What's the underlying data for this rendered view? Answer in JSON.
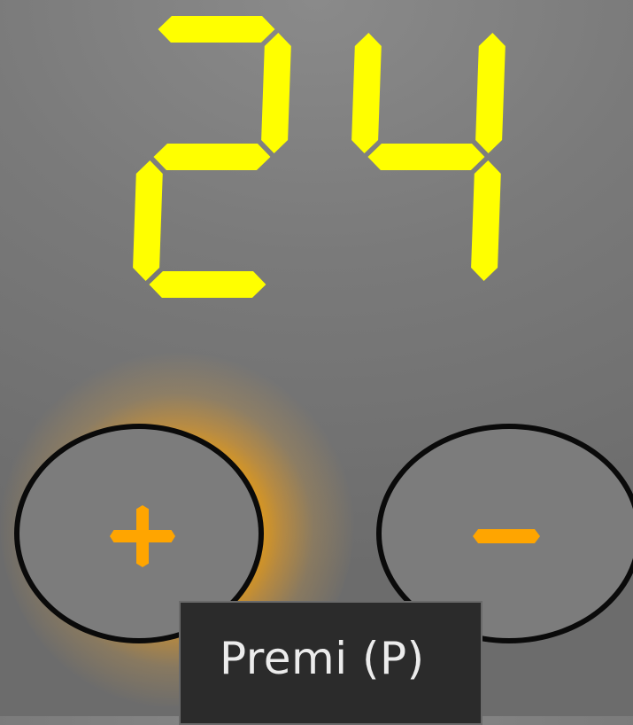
{
  "display": {
    "value": "24",
    "digits": [
      "2",
      "4"
    ]
  },
  "controls": {
    "plus": {
      "symbol": "+",
      "icon": "plus-icon"
    },
    "minus": {
      "symbol": "-",
      "icon": "minus-icon"
    }
  },
  "tooltip": {
    "text": "Premi (P)"
  },
  "colors": {
    "segment_on": "#FFFF00",
    "accent": "#FFA500",
    "background": "#7a7a7a",
    "button_border": "#0a0a0a",
    "tooltip_bg": "#2b2b2b"
  }
}
